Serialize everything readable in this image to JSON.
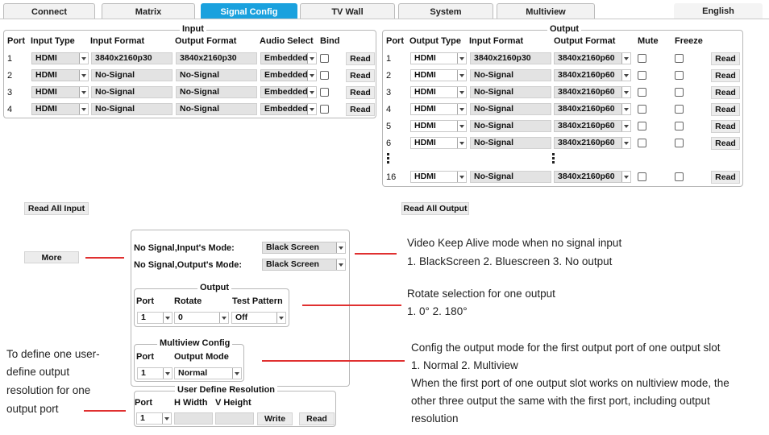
{
  "tabs": [
    {
      "label": "Connect",
      "active": false
    },
    {
      "label": "Matrix",
      "active": false
    },
    {
      "label": "Signal Config",
      "active": true
    },
    {
      "label": "TV Wall",
      "active": false
    },
    {
      "label": "System",
      "active": false
    },
    {
      "label": "Multiview",
      "active": false
    }
  ],
  "language": "English",
  "input": {
    "title": "Input",
    "headers": {
      "port": "Port",
      "type": "Input Type",
      "in_format": "Input Format",
      "out_format": "Output Format",
      "audio": "Audio Select",
      "bind": "Bind"
    },
    "rows": [
      {
        "port": "1",
        "type": "HDMI",
        "in_format": "3840x2160p30",
        "out_format": "3840x2160p30",
        "audio": "Embedded",
        "read": "Read"
      },
      {
        "port": "2",
        "type": "HDMI",
        "in_format": "No-Signal",
        "out_format": "No-Signal",
        "audio": "Embedded",
        "read": "Read"
      },
      {
        "port": "3",
        "type": "HDMI",
        "in_format": "No-Signal",
        "out_format": "No-Signal",
        "audio": "Embedded",
        "read": "Read"
      },
      {
        "port": "4",
        "type": "HDMI",
        "in_format": "No-Signal",
        "out_format": "No-Signal",
        "audio": "Embedded",
        "read": "Read"
      }
    ],
    "read_all": "Read All Input"
  },
  "output": {
    "title": "Output",
    "headers": {
      "port": "Port",
      "type": "Output Type",
      "in_format": "Input Format",
      "out_format": "Output Format",
      "mute": "Mute",
      "freeze": "Freeze"
    },
    "rows": [
      {
        "port": "1",
        "type": "HDMI",
        "in_format": "3840x2160p30",
        "out_format": "3840x2160p60",
        "read": "Read"
      },
      {
        "port": "2",
        "type": "HDMI",
        "in_format": "No-Signal",
        "out_format": "3840x2160p60",
        "read": "Read"
      },
      {
        "port": "3",
        "type": "HDMI",
        "in_format": "No-Signal",
        "out_format": "3840x2160p60",
        "read": "Read"
      },
      {
        "port": "4",
        "type": "HDMI",
        "in_format": "No-Signal",
        "out_format": "3840x2160p60",
        "read": "Read"
      },
      {
        "port": "5",
        "type": "HDMI",
        "in_format": "No-Signal",
        "out_format": "3840x2160p60",
        "read": "Read"
      },
      {
        "port": "6",
        "type": "HDMI",
        "in_format": "No-Signal",
        "out_format": "3840x2160p60",
        "read": "Read"
      }
    ],
    "last_row": {
      "port": "16",
      "type": "HDMI",
      "in_format": "No-Signal",
      "out_format": "3840x2160p60",
      "read": "Read"
    },
    "read_all": "Read All Output"
  },
  "more_button": "More",
  "more_panel": {
    "no_signal_input_label": "No Signal,Input's Mode:",
    "no_signal_input_value": "Black Screen",
    "no_signal_output_label": "No Signal,Output's Mode:",
    "no_signal_output_value": "Black Screen",
    "output_group": {
      "title": "Output",
      "port_h": "Port",
      "rotate_h": "Rotate",
      "pattern_h": "Test Pattern",
      "port": "1",
      "rotate": "0",
      "pattern": "Off"
    },
    "multiview_group": {
      "title": "Multiview Config",
      "port_h": "Port",
      "mode_h": "Output Mode",
      "port": "1",
      "mode": "Normal"
    },
    "udr_group": {
      "title": "User Define Resolution",
      "port_h": "Port",
      "width_h": "H Width",
      "height_h": "V Height",
      "port": "1",
      "write": "Write",
      "read": "Read"
    }
  },
  "notes": {
    "keep_alive_1": "Video Keep Alive mode when no signal input",
    "keep_alive_2": "1. BlackScreen    2. Bluescreen    3. No output",
    "rotate_1": "Rotate selection for one output",
    "rotate_2": "1. 0°          2. 180°",
    "mv_1": "Config the output mode for the first output port of one output slot",
    "mv_2": "1. Normal        2. Multiview",
    "mv_3": "When the first port of one output slot works on nultiview mode, the",
    "mv_4": "other three output the same with the first port, including output",
    "mv_5": "resolution",
    "udr_1": "To define one user-",
    "udr_2": "define output",
    "udr_3": "resolution for one",
    "udr_4": "output port"
  },
  "colors": {
    "accent": "#1aa1de",
    "annotation_line": "#e03030"
  }
}
